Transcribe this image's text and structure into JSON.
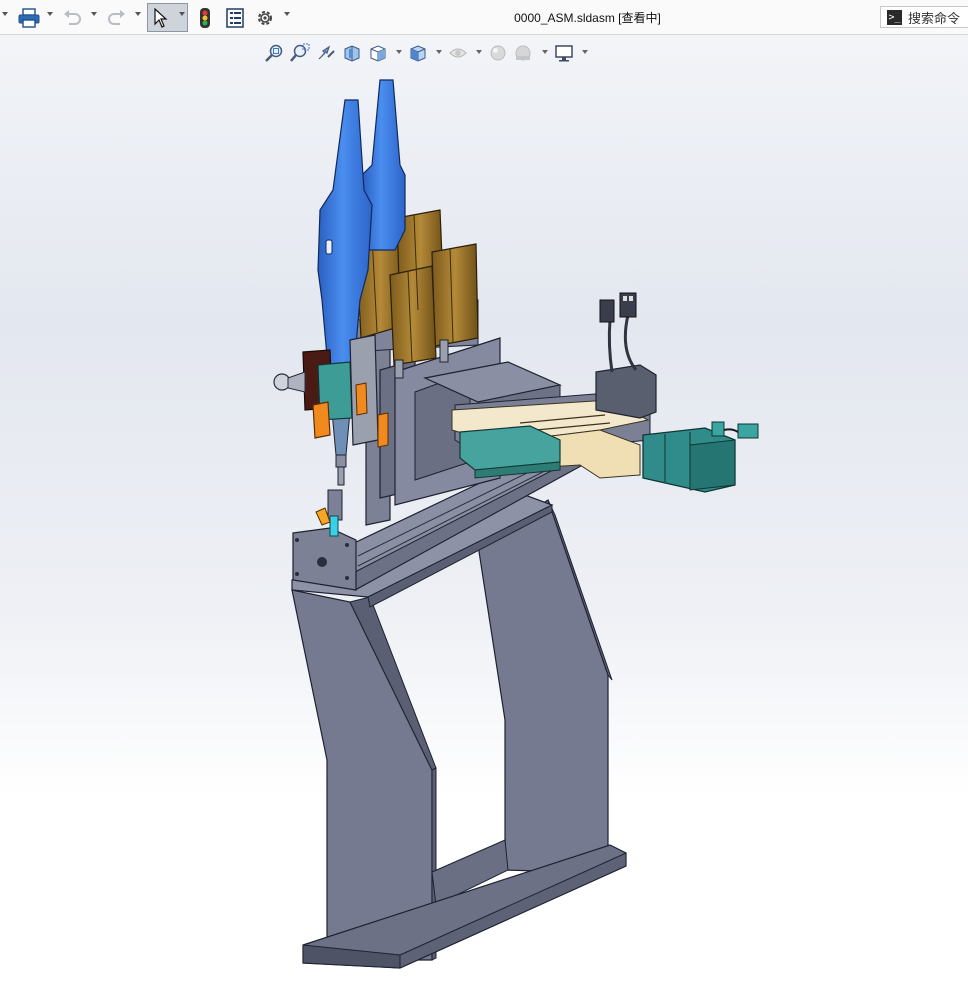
{
  "window": {
    "title": "0000_ASM.sldasm [查看中]"
  },
  "toolbar": {
    "items": [
      {
        "name": "print-icon"
      },
      {
        "name": "undo-icon"
      },
      {
        "name": "redo-icon"
      },
      {
        "name": "select-cursor-icon",
        "selected": true
      },
      {
        "name": "traffic-light-icon"
      },
      {
        "name": "file-properties-icon"
      },
      {
        "name": "gear-icon"
      }
    ]
  },
  "search": {
    "placeholder": "搜索命令",
    "icon": "command-prompt-icon"
  },
  "view_toolbar": {
    "items": [
      {
        "name": "zoom-to-fit-icon"
      },
      {
        "name": "zoom-to-area-icon"
      },
      {
        "name": "previous-view-icon"
      },
      {
        "name": "section-view-icon"
      },
      {
        "name": "view-orientation-icon"
      },
      {
        "name": "display-style-icon"
      },
      {
        "name": "hide-show-items-icon"
      },
      {
        "name": "edit-appearance-icon"
      },
      {
        "name": "apply-scene-icon"
      },
      {
        "name": "view-settings-icon"
      }
    ]
  },
  "colors": {
    "frame_gray": "#7a7f96",
    "frame_dark": "#5f6478",
    "screwdriver_blue": "#3d7fe6",
    "cylinder_brown": "#a07a2e",
    "motor_teal": "#2f8c8a",
    "slide_cream": "#f2e6c8",
    "accent_orange": "#f08a1e"
  }
}
